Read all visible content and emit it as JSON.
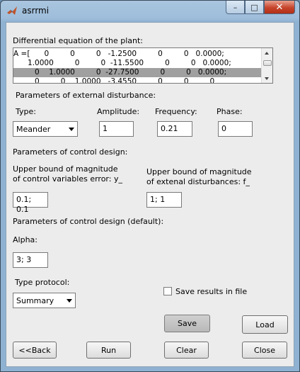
{
  "window": {
    "title": "asrrmi",
    "controls": {
      "minimize_glyph": "–",
      "maximize_glyph": "□",
      "close_glyph": "✕"
    }
  },
  "plant": {
    "heading": "Differential equation of the plant:",
    "rows": [
      "A =[      0         0         0   -1.2500         0         0   0.0000;",
      "      1.0000         0         0  -11.5500         0         0   0.0000;",
      "         0    1.0000         0  -27.7500         0         0   0.0000;",
      "         0         0    1.0000   -3.4550         0         0         0"
    ],
    "selected_row": 2
  },
  "disturbance": {
    "heading": "Parameters of external disturbance:",
    "type_label": "Type:",
    "type_value": "Meander",
    "amplitude_label": "Amplitude:",
    "amplitude_value": "1",
    "frequency_label": "Frequency:",
    "frequency_value": "0.21",
    "phase_label": "Phase:",
    "phase_value": "0"
  },
  "control": {
    "heading": "Parameters of control design:",
    "error_label_1": "Upper bound of magnitude",
    "error_label_2": "of control variables error: y_",
    "error_value": "0.1; 0.1",
    "dist_label_1": "Upper bound of magnitude",
    "dist_label_2": "of extenal disturbances: f_",
    "dist_value": "1; 1"
  },
  "default_design": {
    "heading": "Parameters of control design (default):",
    "alpha_label": "Alpha:",
    "alpha_value": "3; 3"
  },
  "protocol": {
    "label": "Type protocol:",
    "value": "Summary",
    "save_checkbox_label": "Save results in file",
    "save_checked": false
  },
  "buttons": {
    "save": "Save",
    "load": "Load",
    "back": "<<Back",
    "run": "Run",
    "clear": "Clear",
    "close": "Close"
  }
}
